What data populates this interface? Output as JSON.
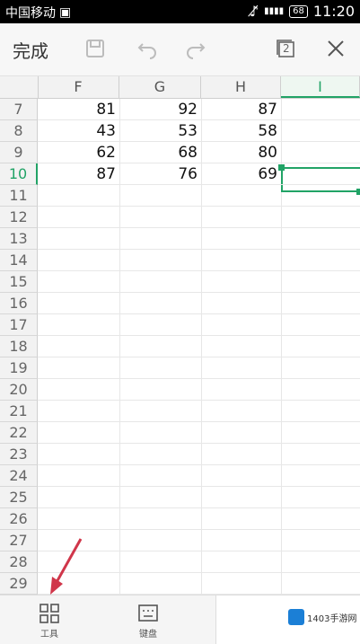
{
  "status": {
    "carrier": "中国移动",
    "battery": "68",
    "time": "11:20"
  },
  "toolbar": {
    "done_label": "完成",
    "sheets_count": "2"
  },
  "sheet": {
    "columns": [
      "F",
      "G",
      "H",
      "I"
    ],
    "active_column": "I",
    "rows": [
      "7",
      "8",
      "9",
      "10",
      "11",
      "12",
      "13",
      "14",
      "15",
      "16",
      "17",
      "18",
      "19",
      "20",
      "21",
      "22",
      "23",
      "24",
      "25",
      "26",
      "27",
      "28",
      "29"
    ],
    "active_row": "10",
    "values": [
      [
        "81",
        "92",
        "87"
      ],
      [
        "43",
        "53",
        "58"
      ],
      [
        "62",
        "68",
        "80"
      ],
      [
        "87",
        "76",
        "69"
      ]
    ]
  },
  "bottombar": {
    "tools_label": "工具",
    "keyboard_label": "键盘"
  },
  "watermark": {
    "text": "1403手游网"
  },
  "colors": {
    "accent": "#21a366",
    "arrow": "#d0364a"
  }
}
